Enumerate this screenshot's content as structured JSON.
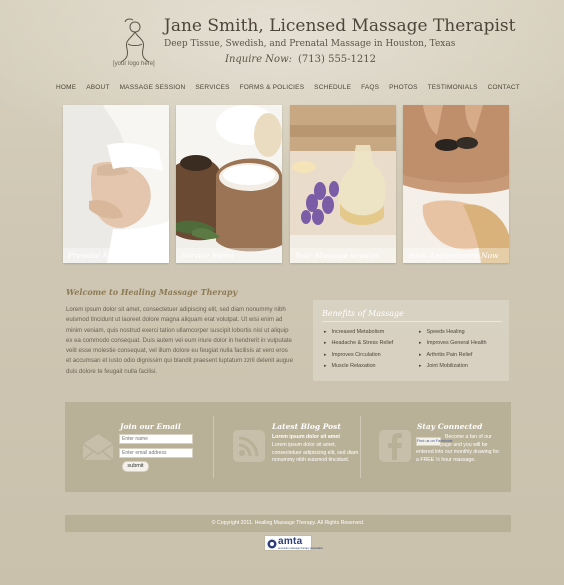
{
  "header": {
    "logo_caption": "[your logo here]",
    "brand_name": "Jane Smith",
    "brand_suffix": ", Licensed Massage Therapist",
    "tagline": "Deep Tissue, Swedish, and Prenatal Massage in Houston, Texas",
    "inquire_label": "Inquire Now:",
    "phone": "(713) 555-1212"
  },
  "nav": {
    "items": [
      "HOME",
      "ABOUT",
      "MASSAGE SESSION",
      "SERVICES",
      "FORMS & POLICIES",
      "SCHEDULE",
      "FAQS",
      "PHOTOS",
      "TESTIMONIALS",
      "CONTACT"
    ]
  },
  "cards": [
    {
      "caption": "Prenatal Massage"
    },
    {
      "caption": "Service Menu"
    },
    {
      "caption": "Your Massage session"
    },
    {
      "caption": "Book Appointment Now"
    }
  ],
  "welcome": {
    "title": "Welcome to Healing Massage Therapy",
    "body": "Lorem ipsum dolor sit amet, consectetuer adipiscing elit, sed diam nonummy nibh euismod tincidunt ut laoreet dolore magna aliquam erat volutpat. Ut wisi enim ad minim veniam, quis nostrud exerci tation ullamcorper suscipit lobortis nisl ut aliquip ex ea commodo consequat. Duis autem vel eum iriure dolor in hendrerit in vulputate velit esse molestie consequat, vel illum dolore eu feugiat nulla facilisis at vero eros et accumsan et iusto odio dignissim qui blandit praesent luptatum zzril delenit augue duis dolore te feugait nulla facilisi."
  },
  "benefits": {
    "title": "Benefits of Massage",
    "left": [
      "Increased Metabolism",
      "Headache & Stress Relief",
      "Improves Circulation",
      "Muscle Relaxation"
    ],
    "right": [
      "Speeds Healing",
      "Improves General Health",
      "Arthritis Pain Relief",
      "Joint Mobilization"
    ]
  },
  "footer": {
    "email": {
      "title": "Join our Email",
      "name_placeholder": "Enter name",
      "email_placeholder": "Enter email address",
      "submit_label": "submit"
    },
    "blog": {
      "title": "Latest Blog Post",
      "headline": "Lorem ipsum dolor sit amet",
      "body": "Lorem ipsum dolor sit amet, consectetuer adipiscing elit, sed diam nonummy nibh euismod tincidunt."
    },
    "social": {
      "title": "Stay Connected",
      "badge": "Find us on Facebook",
      "body": "Become a fan of our Facebook page and you will be entered into our monthly drawing for a FREE ½ hour massage."
    },
    "copyright": "© Copyright 2011. Healing Massage Therapy. All Rights Reserved.",
    "amta_logo": "amta",
    "amta_sub": "american massage therapy association"
  },
  "colors": {
    "background": "#d2cab6",
    "band": "#b9b098",
    "accent_title": "#8c7a55",
    "text": "#6b6253"
  }
}
